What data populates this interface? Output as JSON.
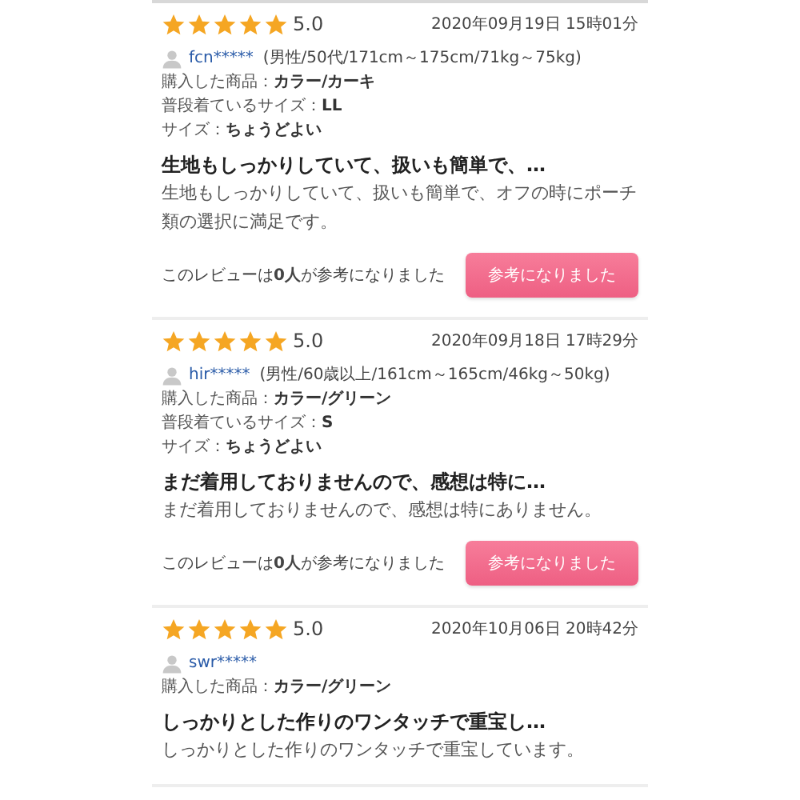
{
  "reviews": [
    {
      "stars": 5,
      "score": "5.0",
      "date": "2020年09月19日 15時01分",
      "user": "fcn*****",
      "profile": "(男性/50代/171cm～175cm/71kg～75kg)",
      "details": [
        {
          "label": "購入した商品：",
          "value": "カラー/カーキ"
        },
        {
          "label": "普段着ているサイズ：",
          "value": "LL"
        },
        {
          "label": "サイズ：",
          "value": "ちょうどよい"
        }
      ],
      "title": "生地もしっかりしていて、扱いも簡単で、…",
      "body": "生地もしっかりしていて、扱いも簡単で、オフの時にポーチ類の選択に満足です。",
      "helpful": "このレビューは**0人**が参考になりました",
      "button": "参考になりました"
    },
    {
      "stars": 5,
      "score": "5.0",
      "date": "2020年09月18日 17時29分",
      "user": "hir*****",
      "profile": "(男性/60歳以上/161cm～165cm/46kg～50kg)",
      "details": [
        {
          "label": "購入した商品：",
          "value": "カラー/グリーン"
        },
        {
          "label": "普段着ているサイズ：",
          "value": "S"
        },
        {
          "label": "サイズ：",
          "value": "ちょうどよい"
        }
      ],
      "title": "まだ着用しておりませんので、感想は特に…",
      "body": "まだ着用しておりませんので、感想は特にありません。",
      "helpful": "このレビューは**0人**が参考になりました",
      "button": "参考になりました"
    },
    {
      "stars": 5,
      "score": "5.0",
      "date": "2020年10月06日 20時42分",
      "user": "swr*****",
      "details": [
        {
          "label": "購入した商品：",
          "value": "カラー/グリーン"
        }
      ],
      "title": "しっかりとした作りのワンタッチで重宝し…",
      "body": "しっかりとした作りのワンタッチで重宝しています。"
    }
  ]
}
